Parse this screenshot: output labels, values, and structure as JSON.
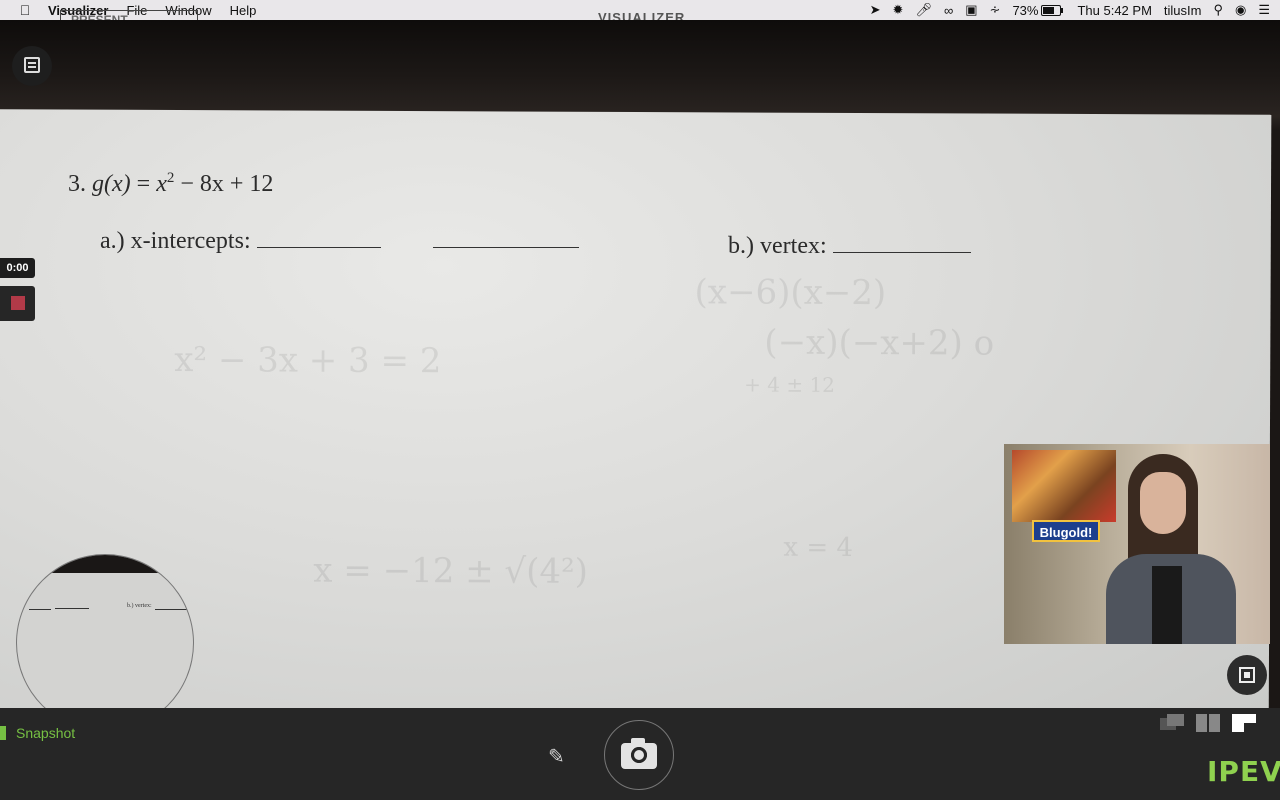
{
  "menubar": {
    "apple_icon": "apple-icon",
    "app_name": "Visualizer",
    "menus": [
      "File",
      "Window",
      "Help"
    ],
    "status": {
      "battery_percent": "73%",
      "datetime": "Thu 5:42 PM",
      "user": "tilusIm"
    }
  },
  "window": {
    "present_button": "PRESENT",
    "title": "VISUALIZER"
  },
  "worksheet": {
    "problem_number": "3.",
    "function_name": "g(x)",
    "expression_lhs_eq": "=",
    "expression_base": "x",
    "expression_exp": "2",
    "expression_rest": "− 8x + 12",
    "part_a_label": "a.)",
    "part_a_text": "x-intercepts:",
    "part_b_label": "b.)",
    "part_b_text": "vertex:"
  },
  "magnifier": {
    "visible_text": "b.) vertex:"
  },
  "recording": {
    "time": "0:00",
    "stop_color": "#b23a48"
  },
  "pip": {
    "banner_text": "Blugold!"
  },
  "bottombar": {
    "snapshot_label": "Snapshot",
    "accent_color": "#76c043",
    "logo": "IPEVO"
  }
}
